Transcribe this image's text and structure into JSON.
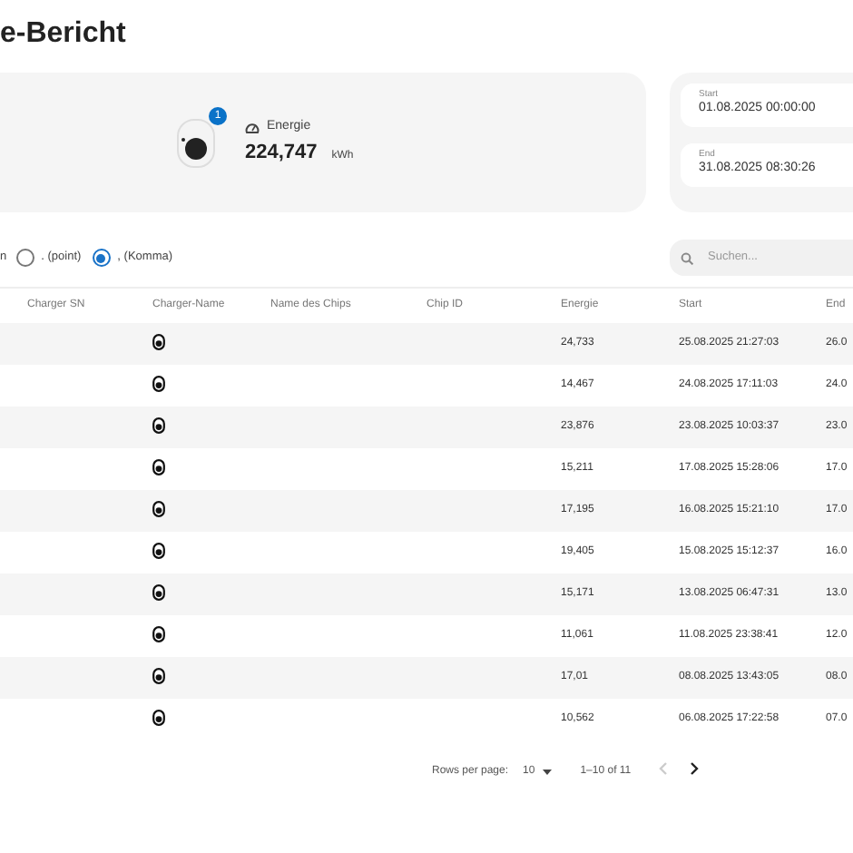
{
  "title": "e-Bericht",
  "summary": {
    "badge": "1",
    "energy_label": "Energie",
    "energy_value": "224,747",
    "energy_unit": "kWh"
  },
  "period": {
    "start_label": "Start",
    "start_value": "01.08.2025 00:00:00",
    "end_label": "End",
    "end_value": "31.08.2025 08:30:26"
  },
  "separator": {
    "label": "n",
    "options": [
      {
        "label": ". (point)",
        "selected": false
      },
      {
        "label": ", (Komma)",
        "selected": true
      }
    ]
  },
  "search": {
    "placeholder": "Suchen..."
  },
  "table": {
    "columns": [
      "Charger SN",
      "Charger-Name",
      "Name des Chips",
      "Chip ID",
      "Energie",
      "Start",
      "End"
    ],
    "rows": [
      {
        "energy": "24,733",
        "start": "25.08.2025 21:27:03",
        "end": "26.0"
      },
      {
        "energy": "14,467",
        "start": "24.08.2025 17:11:03",
        "end": "24.0"
      },
      {
        "energy": "23,876",
        "start": "23.08.2025 10:03:37",
        "end": "23.0"
      },
      {
        "energy": "15,211",
        "start": "17.08.2025 15:28:06",
        "end": "17.0"
      },
      {
        "energy": "17,195",
        "start": "16.08.2025 15:21:10",
        "end": "17.0"
      },
      {
        "energy": "19,405",
        "start": "15.08.2025 15:12:37",
        "end": "16.0"
      },
      {
        "energy": "15,171",
        "start": "13.08.2025 06:47:31",
        "end": "13.0"
      },
      {
        "energy": "11,061",
        "start": "11.08.2025 23:38:41",
        "end": "12.0"
      },
      {
        "energy": "17,01",
        "start": "08.08.2025 13:43:05",
        "end": "08.0"
      },
      {
        "energy": "10,562",
        "start": "06.08.2025 17:22:58",
        "end": "07.0"
      }
    ]
  },
  "pagination": {
    "rows_label": "Rows per page:",
    "rows_value": "10",
    "range": "1–10 of 11",
    "prev_disabled": true,
    "next_disabled": false
  }
}
